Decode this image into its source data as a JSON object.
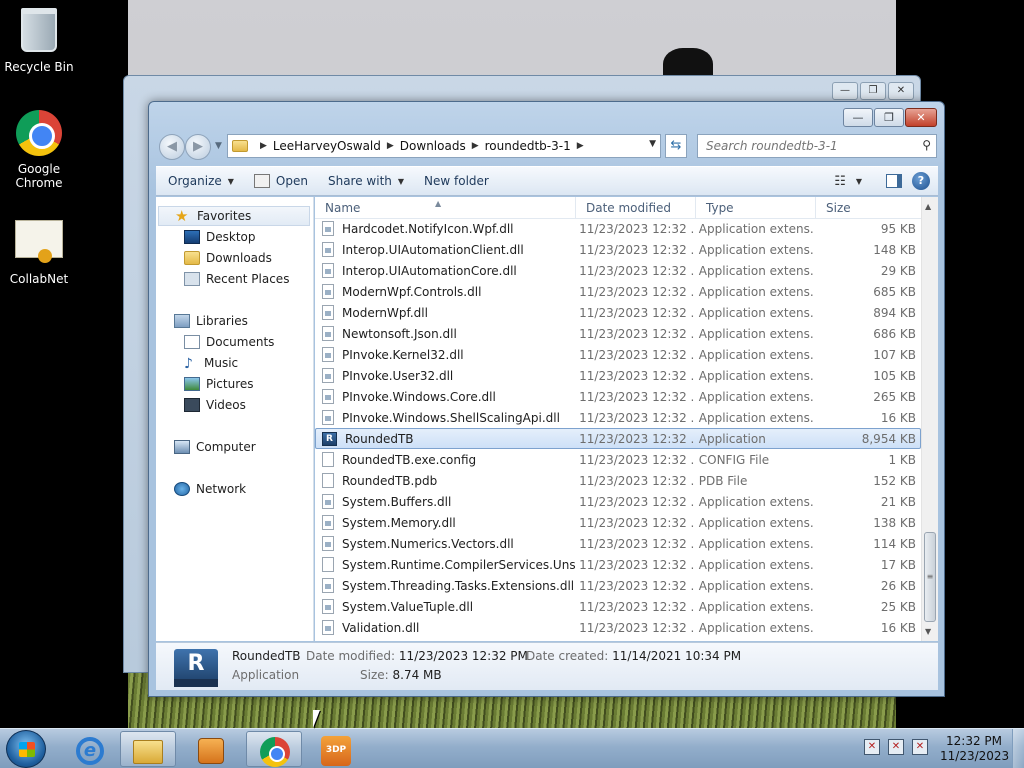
{
  "desktop": {
    "icons": [
      {
        "label": "Recycle Bin",
        "icon": "recycle-bin-icon"
      },
      {
        "label": "Google Chrome",
        "icon": "chrome-icon"
      },
      {
        "label": "CollabNet",
        "icon": "certificate-icon"
      }
    ]
  },
  "window": {
    "caption": {
      "minimize": "—",
      "maximize": "❐",
      "close": "✕"
    },
    "address": {
      "crumbs": [
        "LeeHarveyOswald",
        "Downloads",
        "roundedtb-3-1"
      ]
    },
    "search": {
      "placeholder": "Search roundedtb-3-1"
    },
    "toolbar": {
      "organize": "Organize",
      "open": "Open",
      "share_with": "Share with",
      "new_folder": "New folder"
    },
    "nav": {
      "favorites": "Favorites",
      "desktop": "Desktop",
      "downloads": "Downloads",
      "recent_places": "Recent Places",
      "libraries": "Libraries",
      "documents": "Documents",
      "music": "Music",
      "pictures": "Pictures",
      "videos": "Videos",
      "computer": "Computer",
      "network": "Network"
    },
    "columns": {
      "name": "Name",
      "date": "Date modified",
      "type": "Type",
      "size": "Size"
    },
    "files": [
      {
        "name": "Hardcodet.NotifyIcon.Wpf.dll",
        "date": "11/23/2023 12:32 ...",
        "type": "Application extens...",
        "size": "95 KB"
      },
      {
        "name": "Interop.UIAutomationClient.dll",
        "date": "11/23/2023 12:32 ...",
        "type": "Application extens...",
        "size": "148 KB"
      },
      {
        "name": "Interop.UIAutomationCore.dll",
        "date": "11/23/2023 12:32 ...",
        "type": "Application extens...",
        "size": "29 KB"
      },
      {
        "name": "ModernWpf.Controls.dll",
        "date": "11/23/2023 12:32 ...",
        "type": "Application extens...",
        "size": "685 KB"
      },
      {
        "name": "ModernWpf.dll",
        "date": "11/23/2023 12:32 ...",
        "type": "Application extens...",
        "size": "894 KB"
      },
      {
        "name": "Newtonsoft.Json.dll",
        "date": "11/23/2023 12:32 ...",
        "type": "Application extens...",
        "size": "686 KB"
      },
      {
        "name": "PInvoke.Kernel32.dll",
        "date": "11/23/2023 12:32 ...",
        "type": "Application extens...",
        "size": "107 KB"
      },
      {
        "name": "PInvoke.User32.dll",
        "date": "11/23/2023 12:32 ...",
        "type": "Application extens...",
        "size": "105 KB"
      },
      {
        "name": "PInvoke.Windows.Core.dll",
        "date": "11/23/2023 12:32 ...",
        "type": "Application extens...",
        "size": "265 KB"
      },
      {
        "name": "PInvoke.Windows.ShellScalingApi.dll",
        "date": "11/23/2023 12:32 ...",
        "type": "Application extens...",
        "size": "16 KB"
      },
      {
        "name": "RoundedTB",
        "date": "11/23/2023 12:32 ...",
        "type": "Application",
        "size": "8,954 KB"
      },
      {
        "name": "RoundedTB.exe.config",
        "date": "11/23/2023 12:32 ...",
        "type": "CONFIG File",
        "size": "1 KB"
      },
      {
        "name": "RoundedTB.pdb",
        "date": "11/23/2023 12:32 ...",
        "type": "PDB File",
        "size": "152 KB"
      },
      {
        "name": "System.Buffers.dll",
        "date": "11/23/2023 12:32 ...",
        "type": "Application extens...",
        "size": "21 KB"
      },
      {
        "name": "System.Memory.dll",
        "date": "11/23/2023 12:32 ...",
        "type": "Application extens...",
        "size": "138 KB"
      },
      {
        "name": "System.Numerics.Vectors.dll",
        "date": "11/23/2023 12:32 ...",
        "type": "Application extens...",
        "size": "114 KB"
      },
      {
        "name": "System.Runtime.CompilerServices.Unsaf...",
        "date": "11/23/2023 12:32 ...",
        "type": "Application extens...",
        "size": "17 KB"
      },
      {
        "name": "System.Threading.Tasks.Extensions.dll",
        "date": "11/23/2023 12:32 ...",
        "type": "Application extens...",
        "size": "26 KB"
      },
      {
        "name": "System.ValueTuple.dll",
        "date": "11/23/2023 12:32 ...",
        "type": "Application extens...",
        "size": "25 KB"
      },
      {
        "name": "Validation.dll",
        "date": "11/23/2023 12:32 ...",
        "type": "Application extens...",
        "size": "16 KB"
      }
    ],
    "details": {
      "icon_letter": "R",
      "name": "RoundedTB",
      "type": "Application",
      "date_modified_label": "Date modified:",
      "date_modified": "11/23/2023 12:32 PM",
      "date_created_label": "Date created:",
      "date_created": "11/14/2021 10:34 PM",
      "size_label": "Size:",
      "size": "8.74 MB"
    }
  },
  "taskbar": {
    "tdp_label": "3DP",
    "clock_time": "12:32 PM",
    "clock_date": "11/23/2023"
  }
}
